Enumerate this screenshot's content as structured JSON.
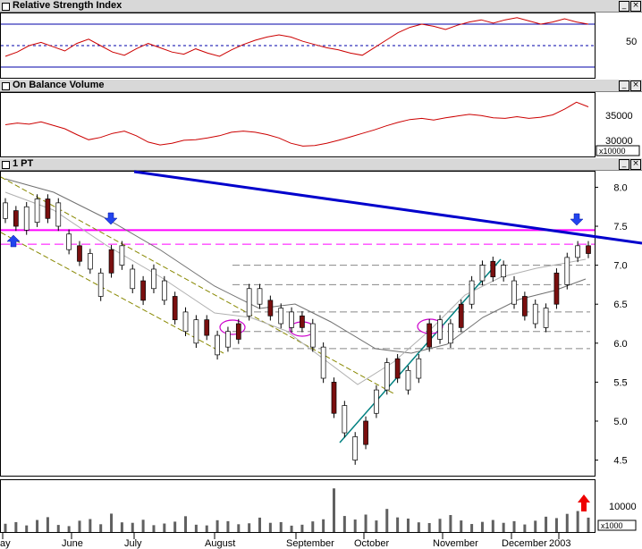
{
  "panels": {
    "rsi": {
      "title": "Relative Strength Index",
      "tick": "50"
    },
    "obv": {
      "title": "On Balance Volume",
      "ticks": [
        "35000",
        "30000"
      ],
      "multiplier": "x10000"
    },
    "price": {
      "title": "1 PT",
      "ticks": [
        "8.0",
        "7.5",
        "7.0",
        "6.5",
        "6.0",
        "5.5",
        "5.0",
        "4.5"
      ]
    },
    "volume": {
      "tick": "10000",
      "multiplier": "x1000"
    }
  },
  "x_labels": [
    "ay",
    "June",
    "July",
    "August",
    "September",
    "October",
    "November",
    "December",
    "2003"
  ],
  "chart_data": [
    {
      "type": "line",
      "title": "Relative Strength Index",
      "ylim": [
        20,
        80
      ],
      "reference_lines": [
        30,
        50,
        70
      ],
      "series": [
        {
          "values": [
            40,
            44,
            50,
            53,
            49,
            45,
            52,
            56,
            50,
            44,
            41,
            47,
            52,
            48,
            44,
            42,
            47,
            43,
            40,
            46,
            51,
            55,
            58,
            60,
            58,
            54,
            51,
            48,
            46,
            43,
            41,
            48,
            55,
            62,
            67,
            70,
            68,
            65,
            69,
            72,
            74,
            71,
            74,
            76,
            73,
            70,
            72,
            75,
            72,
            70
          ]
        }
      ]
    },
    {
      "type": "line",
      "title": "On Balance Volume",
      "ylim": [
        29000,
        40000
      ],
      "series": [
        {
          "values": [
            34500,
            34800,
            34600,
            35000,
            34400,
            33800,
            32800,
            31900,
            32300,
            33000,
            33400,
            32600,
            31500,
            31000,
            31300,
            31800,
            31900,
            32200,
            32600,
            33200,
            33400,
            33200,
            32800,
            32200,
            31300,
            30800,
            30900,
            31300,
            31800,
            32400,
            33000,
            33600,
            34300,
            34900,
            35400,
            35600,
            35300,
            35700,
            36000,
            36300,
            36100,
            35700,
            35600,
            35900,
            35600,
            35800,
            36200,
            37200,
            38400,
            37600
          ]
        }
      ]
    },
    {
      "type": "candlestick",
      "title": "1 PT",
      "ylim": [
        4.3,
        8.2
      ],
      "candles": [
        [
          7.6,
          7.8
        ],
        [
          7.5,
          7.7
        ],
        [
          7.45,
          7.75
        ],
        [
          7.55,
          7.85
        ],
        [
          7.6,
          7.85
        ],
        [
          7.5,
          7.8
        ],
        [
          7.2,
          7.4
        ],
        [
          7.05,
          7.25
        ],
        [
          6.95,
          7.15
        ],
        [
          6.6,
          6.9
        ],
        [
          6.9,
          7.2
        ],
        [
          7.0,
          7.25
        ],
        [
          6.7,
          6.95
        ],
        [
          6.55,
          6.8
        ],
        [
          6.7,
          6.95
        ],
        [
          6.55,
          6.8
        ],
        [
          6.3,
          6.6
        ],
        [
          6.15,
          6.4
        ],
        [
          6.0,
          6.3
        ],
        [
          6.1,
          6.3
        ],
        [
          5.85,
          6.1
        ],
        [
          5.95,
          6.15
        ],
        [
          6.05,
          6.25
        ],
        [
          6.35,
          6.7
        ],
        [
          6.5,
          6.7
        ],
        [
          6.35,
          6.55
        ],
        [
          6.25,
          6.45
        ],
        [
          6.2,
          6.4
        ],
        [
          6.2,
          6.35
        ],
        [
          5.95,
          6.25
        ],
        [
          5.55,
          5.95
        ],
        [
          5.1,
          5.5
        ],
        [
          4.85,
          5.2
        ],
        [
          4.5,
          4.8
        ],
        [
          4.7,
          5.0
        ],
        [
          5.1,
          5.4
        ],
        [
          5.4,
          5.75
        ],
        [
          5.55,
          5.8
        ],
        [
          5.4,
          5.65
        ],
        [
          5.55,
          5.8
        ],
        [
          5.95,
          6.25
        ],
        [
          6.05,
          6.3
        ],
        [
          6.0,
          6.25
        ],
        [
          6.2,
          6.5
        ],
        [
          6.5,
          6.8
        ],
        [
          6.8,
          7.0
        ],
        [
          6.85,
          7.05
        ],
        [
          6.85,
          7.0
        ],
        [
          6.5,
          6.8
        ],
        [
          6.35,
          6.6
        ],
        [
          6.25,
          6.5
        ],
        [
          6.2,
          6.45
        ],
        [
          6.5,
          6.9
        ],
        [
          6.75,
          7.1
        ],
        [
          7.1,
          7.25
        ],
        [
          7.15,
          7.25
        ]
      ],
      "resistance_lines": [
        7.45,
        7.27
      ],
      "support_lines": [
        7.0,
        6.75,
        6.4,
        6.15,
        5.93
      ]
    },
    {
      "type": "bar",
      "title": "Volume",
      "ylim": [
        0,
        22000
      ],
      "values": [
        3500,
        4200,
        2800,
        5100,
        6300,
        3000,
        2500,
        4800,
        5500,
        3300,
        7800,
        4100,
        3900,
        5200,
        2900,
        3600,
        4400,
        6700,
        3100,
        2800,
        5000,
        4600,
        3300,
        3700,
        6100,
        3900,
        4200,
        2700,
        3100,
        4500,
        5400,
        18500,
        6800,
        5300,
        7400,
        4900,
        9800,
        6200,
        5700,
        4100,
        3800,
        5600,
        7200,
        4900,
        3400,
        4300,
        5100,
        3900,
        4600,
        3200,
        4800,
        6500,
        5900,
        7700,
        8900,
        6100
      ]
    }
  ]
}
